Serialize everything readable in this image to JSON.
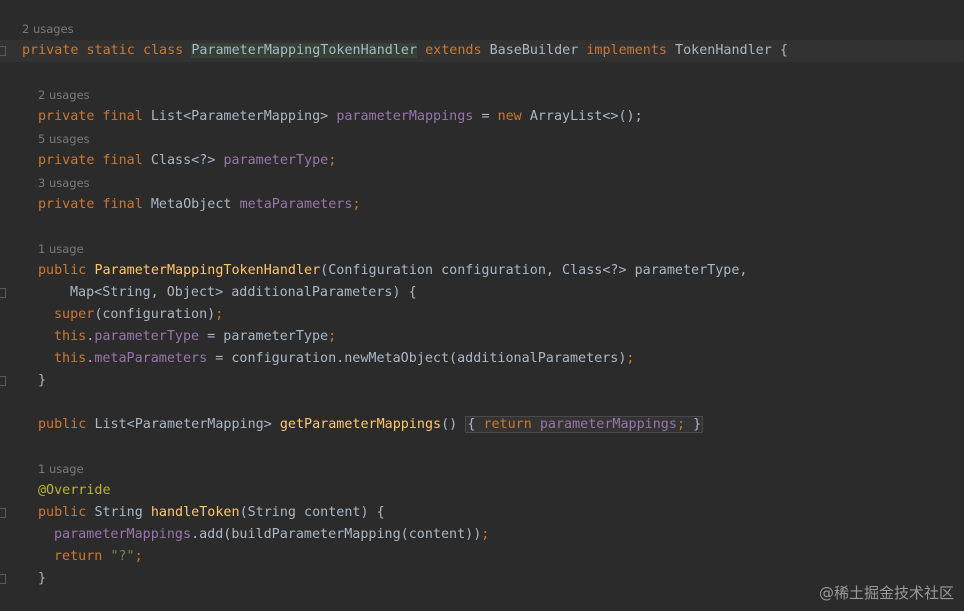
{
  "editor": {
    "hints": {
      "class_usages": "2 usages",
      "mappings_usages": "2 usages",
      "type_usages": "5 usages",
      "meta_usages": "3 usages",
      "ctor_usages": "1 usage",
      "handle_usages": "1 usage"
    },
    "code": {
      "l1": {
        "private": "private",
        "static": "static",
        "class": "class",
        "name": "ParameterMappingTokenHandler",
        "extends": "extends",
        "base": "BaseBuilder",
        "implements": "implements",
        "iface": "TokenHandler",
        "brace": "{"
      },
      "l2": {
        "private": "private",
        "final": "final",
        "type": "List<ParameterMapping>",
        "field": "parameterMappings",
        "eq": "=",
        "new": "new",
        "rest": "ArrayList<>();"
      },
      "l3": {
        "private": "private",
        "final": "final",
        "type": "Class<?>",
        "field": "parameterType",
        "semi": ";"
      },
      "l4": {
        "private": "private",
        "final": "final",
        "type": "MetaObject",
        "field": "metaParameters",
        "semi": ";"
      },
      "l5": {
        "public": "public",
        "name": "ParameterMappingTokenHandler",
        "rest": "(Configuration configuration, Class<?> parameterType,"
      },
      "l6": {
        "text": "Map<String, Object> additionalParameters) {"
      },
      "l7": {
        "super": "super",
        "rest": "(configuration)",
        "semi": ";"
      },
      "l8": {
        "this": "this",
        "dot": ".",
        "field": "parameterType",
        "rest": " = parameterType",
        "semi": ";"
      },
      "l9": {
        "this": "this",
        "dot": ".",
        "field": "metaParameters",
        "rest": " = configuration.newMetaObject(additionalParameters)",
        "semi": ";"
      },
      "l10": {
        "brace": "}"
      },
      "l11": {
        "public": "public",
        "type": "List<ParameterMapping>",
        "name": "getParameterMappings",
        "parens": "()",
        "open": "{",
        "return": "return",
        "field": "parameterMappings",
        "semi": ";",
        "close": "}"
      },
      "l12": {
        "annotation": "@Override"
      },
      "l13": {
        "public": "public",
        "type": "String",
        "name": "handleToken",
        "rest": "(String content) {"
      },
      "l14": {
        "field": "parameterMappings",
        "rest": ".add(buildParameterMapping(content))",
        "semi": ";"
      },
      "l15": {
        "return": "return",
        "str": "\"?\"",
        "semi": ";"
      },
      "l16": {
        "brace": "}"
      }
    }
  },
  "watermark": "@稀土掘金技术社区",
  "colors": {
    "background": "#2b2b2b",
    "keyword": "#cc7832",
    "field": "#9876aa",
    "method": "#ffc66d",
    "string": "#6a8759",
    "annotation": "#bbb529",
    "text": "#a9b7c6",
    "hint": "#7a7a7a"
  }
}
